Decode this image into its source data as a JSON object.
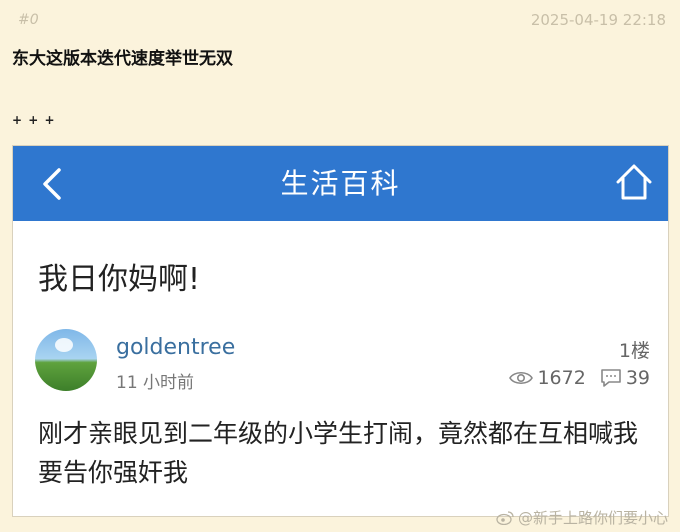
{
  "post": {
    "number": "#0",
    "date": "2025-04-19 22:18",
    "title": "东大这版本迭代速度举世无双",
    "decoration": "+ + +"
  },
  "screenshot": {
    "app_title": "生活百科",
    "thread_title": "我日你妈啊!",
    "username": "goldentree",
    "time_ago": "11 小时前",
    "floor": "1楼",
    "views": "1672",
    "comments": "39",
    "body": "刚才亲眼见到二年级的小学生打闹，竟然都在互相喊我要告你强奸我"
  },
  "watermark": {
    "text": "@新手上路你们要小心"
  },
  "colors": {
    "page_bg": "#fbf3dc",
    "appbar_blue": "#2f77cf",
    "username_blue": "#3a6f9f"
  }
}
